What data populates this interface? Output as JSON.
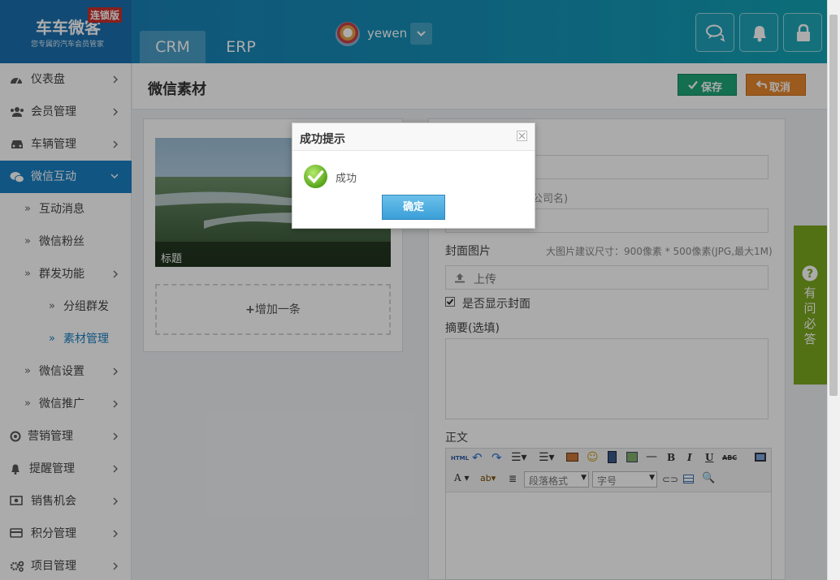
{
  "brand": {
    "name": "车车微客",
    "tagline": "您专属的汽车会员管家",
    "badge": "连锁版"
  },
  "top_tabs": [
    {
      "label": "CRM"
    },
    {
      "label": "ERP"
    }
  ],
  "user": {
    "name": "yewen"
  },
  "top_icons": [
    "chat-icon",
    "bell-icon",
    "lock-icon"
  ],
  "sidebar": {
    "items": [
      {
        "label": "仪表盘",
        "icon": "dashboard-icon"
      },
      {
        "label": "会员管理",
        "icon": "users-icon"
      },
      {
        "label": "车辆管理",
        "icon": "car-icon"
      },
      {
        "label": "微信互动",
        "icon": "wechat-icon",
        "active": true
      },
      {
        "label": "互动消息",
        "icon": "double-chevron-right"
      },
      {
        "label": "微信粉丝",
        "icon": "double-chevron-right"
      },
      {
        "label": "群发功能",
        "icon": "double-chevron-right"
      },
      {
        "label": "分组群发",
        "icon": "double-chevron-right"
      },
      {
        "label": "素材管理",
        "icon": "double-chevron-right",
        "current": true
      },
      {
        "label": "微信设置",
        "icon": "double-chevron-right"
      },
      {
        "label": "微信推广",
        "icon": "double-chevron-right"
      },
      {
        "label": "营销管理",
        "icon": "target-icon"
      },
      {
        "label": "提醒管理",
        "icon": "bell-icon"
      },
      {
        "label": "销售机会",
        "icon": "money-icon"
      },
      {
        "label": "积分管理",
        "icon": "card-icon"
      },
      {
        "label": "项目管理",
        "icon": "gears-icon"
      }
    ]
  },
  "page": {
    "title": "微信素材",
    "save_label": "保存",
    "cancel_label": "取消"
  },
  "left_panel": {
    "cover_title": "标题",
    "add_label": "增加一条"
  },
  "form": {
    "author_hint_fragment": "公司名)",
    "cover_label": "封面图片",
    "cover_hint": "大图片建议尺寸：900像素 * 500像素(JPG,最大1M)",
    "upload_label": "上传",
    "show_cover_label": "是否显示封面",
    "show_cover_checked": true,
    "summary_label": "摘要(选填)",
    "body_label": "正文",
    "editor": {
      "format_placeholder": "段落格式",
      "size_placeholder": "字号"
    }
  },
  "help": {
    "label": "有问必答"
  },
  "dialog": {
    "title": "成功提示",
    "message": "成功",
    "ok_label": "确定"
  },
  "colors": {
    "primary": "#1a7fc2",
    "save": "#1fa67a",
    "cancel": "#e8872d",
    "help": "#7ba81e"
  }
}
